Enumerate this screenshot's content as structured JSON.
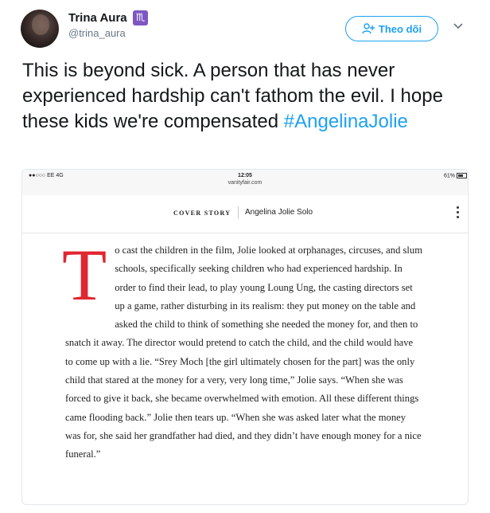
{
  "user": {
    "display_name": "Trina Aura",
    "zodiac_glyph": "♏",
    "handle": "@trina_aura"
  },
  "follow_button": {
    "label": "Theo dõi"
  },
  "tweet": {
    "text": "This is beyond sick. A person that has never experienced hardship can't fathom the evil. I hope these kids we're compensated ",
    "hashtag": "#AngelinaJolie"
  },
  "screenshot": {
    "status_bar": {
      "carrier": "●●○○○ EE  4G",
      "time": "12:05",
      "url": "vanityfair.com",
      "battery": "61%"
    },
    "nav": {
      "section": "COVER STORY",
      "title": "Angelina Jolie Solo"
    },
    "article": {
      "drop_cap": "T",
      "body": "o cast the children in the film, Jolie looked at orphanages, circuses, and slum schools, specifically seeking children who had experienced hardship. In order to find their lead, to play young Loung Ung, the casting directors set up a game, rather disturbing in its realism: they put money on the table and asked the child to think of something she needed the money for, and then to snatch it away. The director would pretend to catch the child, and the child would have to come up with a lie. “Srey Moch [the girl ultimately chosen for the part] was the only child that stared at the money for a very, very long time,” Jolie says. “When she was forced to give it back, she became overwhelmed with emotion. All these different things came flooding back.” Jolie then tears up. “When she was asked later what the money was for, she said her grandfather had died, and they didn’t have enough money for a nice funeral.”"
    }
  },
  "colors": {
    "link": "#1da1f2",
    "drop_cap": "#e0262f",
    "zodiac_badge": "#7e57c2"
  },
  "icons": {
    "follow": "add-user-icon",
    "menu": "chevron-down-icon"
  }
}
